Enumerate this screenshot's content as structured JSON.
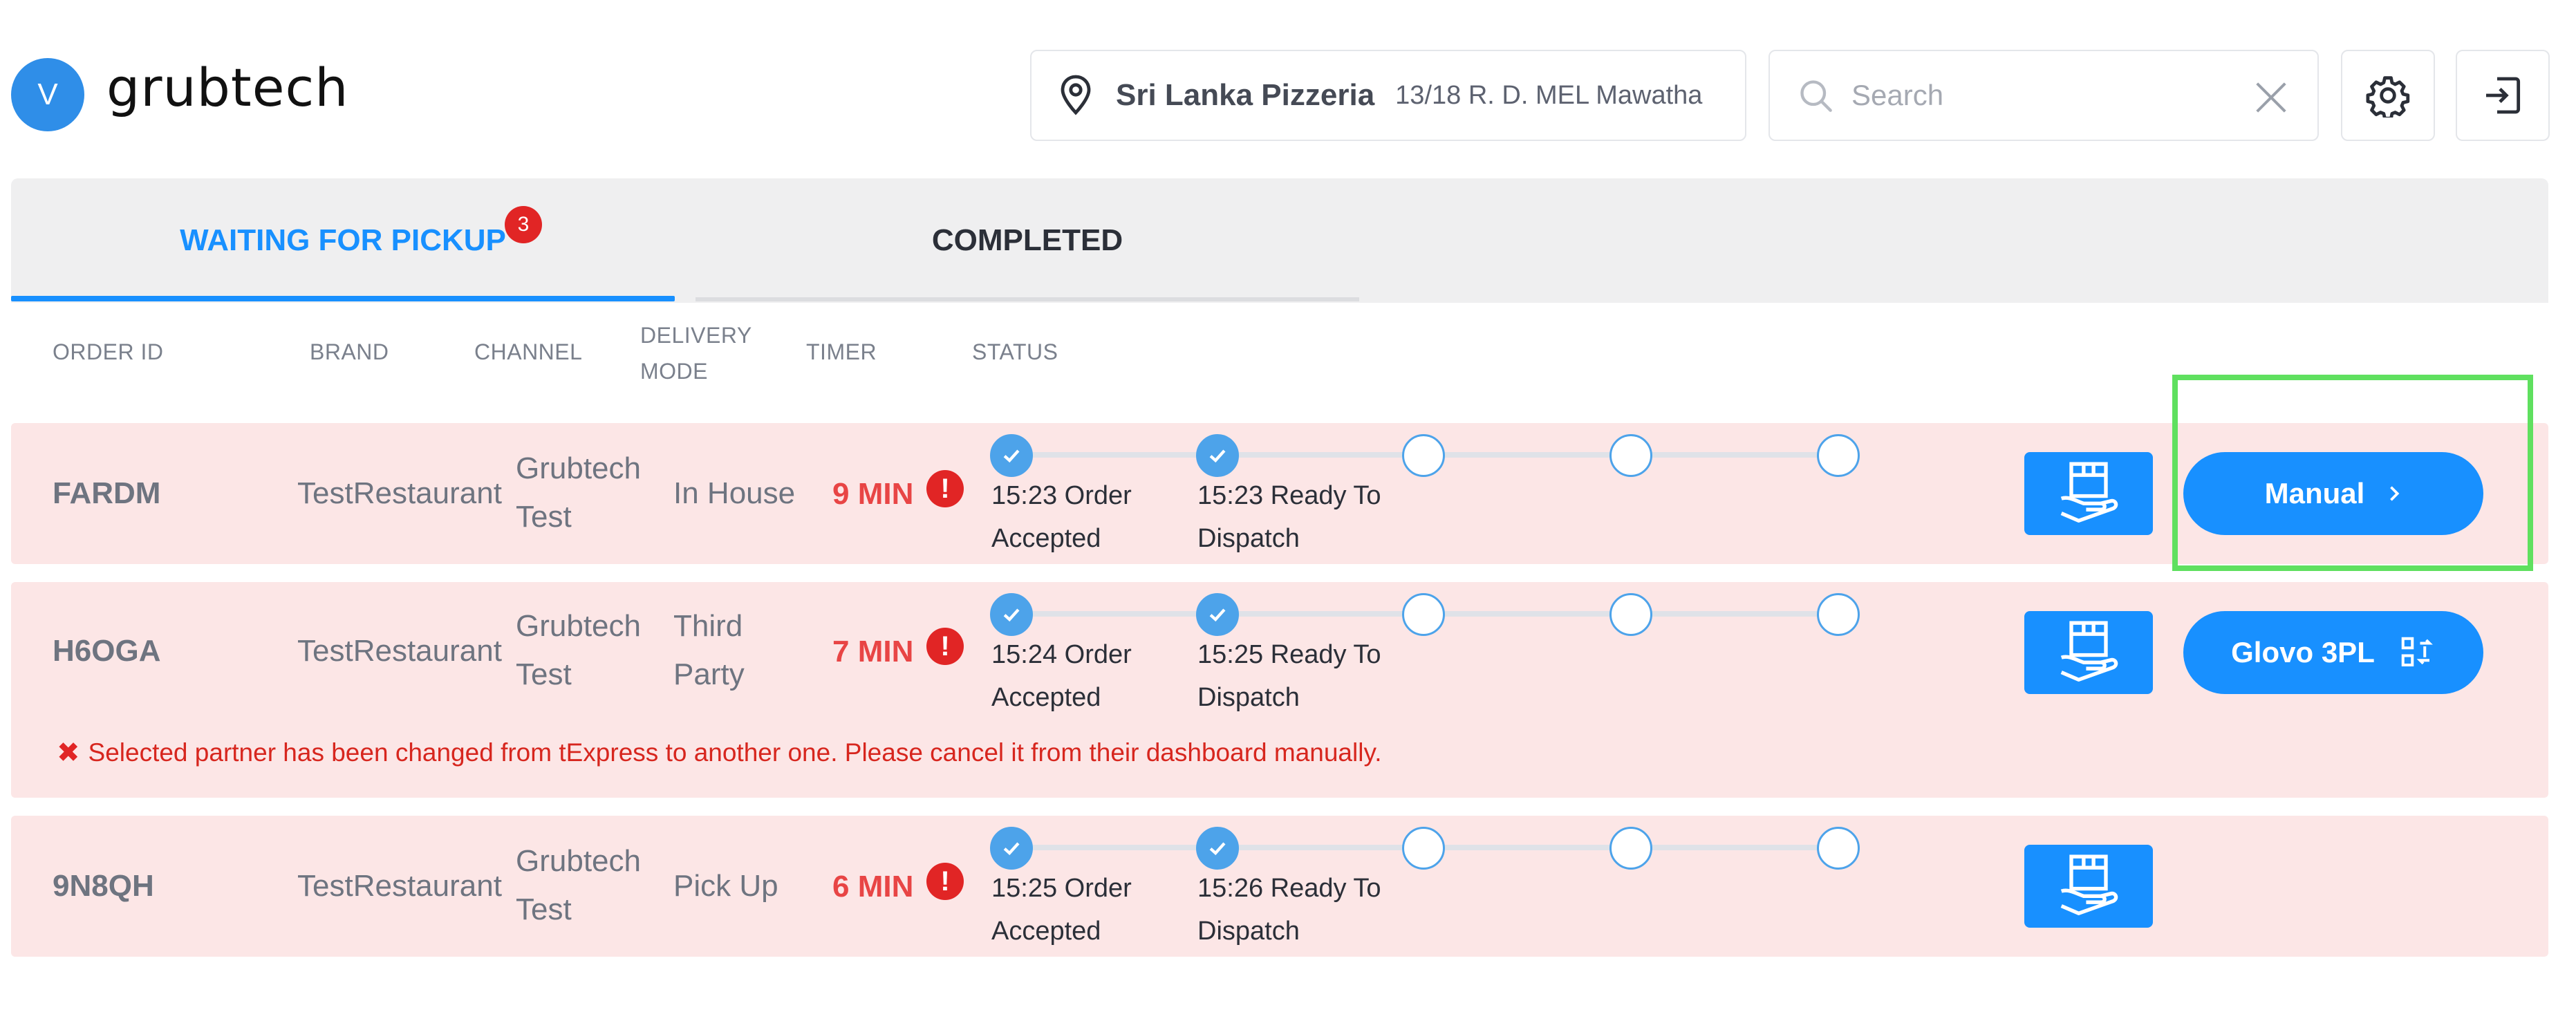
{
  "header": {
    "avatar_initial": "V",
    "logo_text": "grubtech",
    "location": {
      "name": "Sri Lanka Pizzeria",
      "address": "13/18 R. D. MEL Mawatha"
    },
    "search": {
      "placeholder": "Search",
      "value": ""
    }
  },
  "tabs": [
    {
      "label": "WAITING FOR PICKUP",
      "badge": "3",
      "active": true
    },
    {
      "label": "COMPLETED",
      "active": false
    }
  ],
  "columns": {
    "order_id": "ORDER ID",
    "brand": "BRAND",
    "channel": "CHANNEL",
    "delivery_mode_1": "DELIVERY",
    "delivery_mode_2": "MODE",
    "timer": "TIMER",
    "status": "STATUS"
  },
  "orders": [
    {
      "id": "FARDM",
      "brand": "TestRestaurant",
      "channel_1": "Grubtech",
      "channel_2": "Test",
      "mode_1": "In House",
      "mode_2": "",
      "timer": "9 MIN",
      "alert": "!",
      "steps_done": 2,
      "step1_line1": "15:23 Order",
      "step1_line2": "Accepted",
      "step2_line1": "15:23 Ready To",
      "step2_line2": "Dispatch",
      "action_label": "Manual"
    },
    {
      "id": "H6OGA",
      "brand": "TestRestaurant",
      "channel_1": "Grubtech",
      "channel_2": "Test",
      "mode_1": "Third",
      "mode_2": "Party",
      "timer": "7 MIN",
      "alert": "!",
      "steps_done": 2,
      "step1_line1": "15:24 Order",
      "step1_line2": "Accepted",
      "step2_line1": "15:25 Ready To",
      "step2_line2": "Dispatch",
      "action_label": "Glovo 3PL",
      "error": "Selected partner has been changed from tExpress to another one. Please cancel it from their dashboard manually."
    },
    {
      "id": "9N8QH",
      "brand": "TestRestaurant",
      "channel_1": "Grubtech",
      "channel_2": "Test",
      "mode_1": "Pick Up",
      "mode_2": "",
      "timer": "6 MIN",
      "alert": "!",
      "steps_done": 2,
      "step1_line1": "15:25 Order",
      "step1_line2": "Accepted",
      "step2_line1": "15:26 Ready To",
      "step2_line2": "Dispatch"
    }
  ],
  "colors": {
    "accent": "#1890ff",
    "row_bg": "#fce6e6",
    "timer": "#e84545",
    "error": "#d7261e",
    "highlight": "#5fe05f"
  },
  "icons": {
    "location": "map-pin-icon",
    "search": "search-icon",
    "clear": "close-icon",
    "settings": "gear-icon",
    "logout": "logout-icon",
    "package": "package-hand-icon",
    "chevron": "chevron-right-icon",
    "swap": "swap-icon"
  }
}
